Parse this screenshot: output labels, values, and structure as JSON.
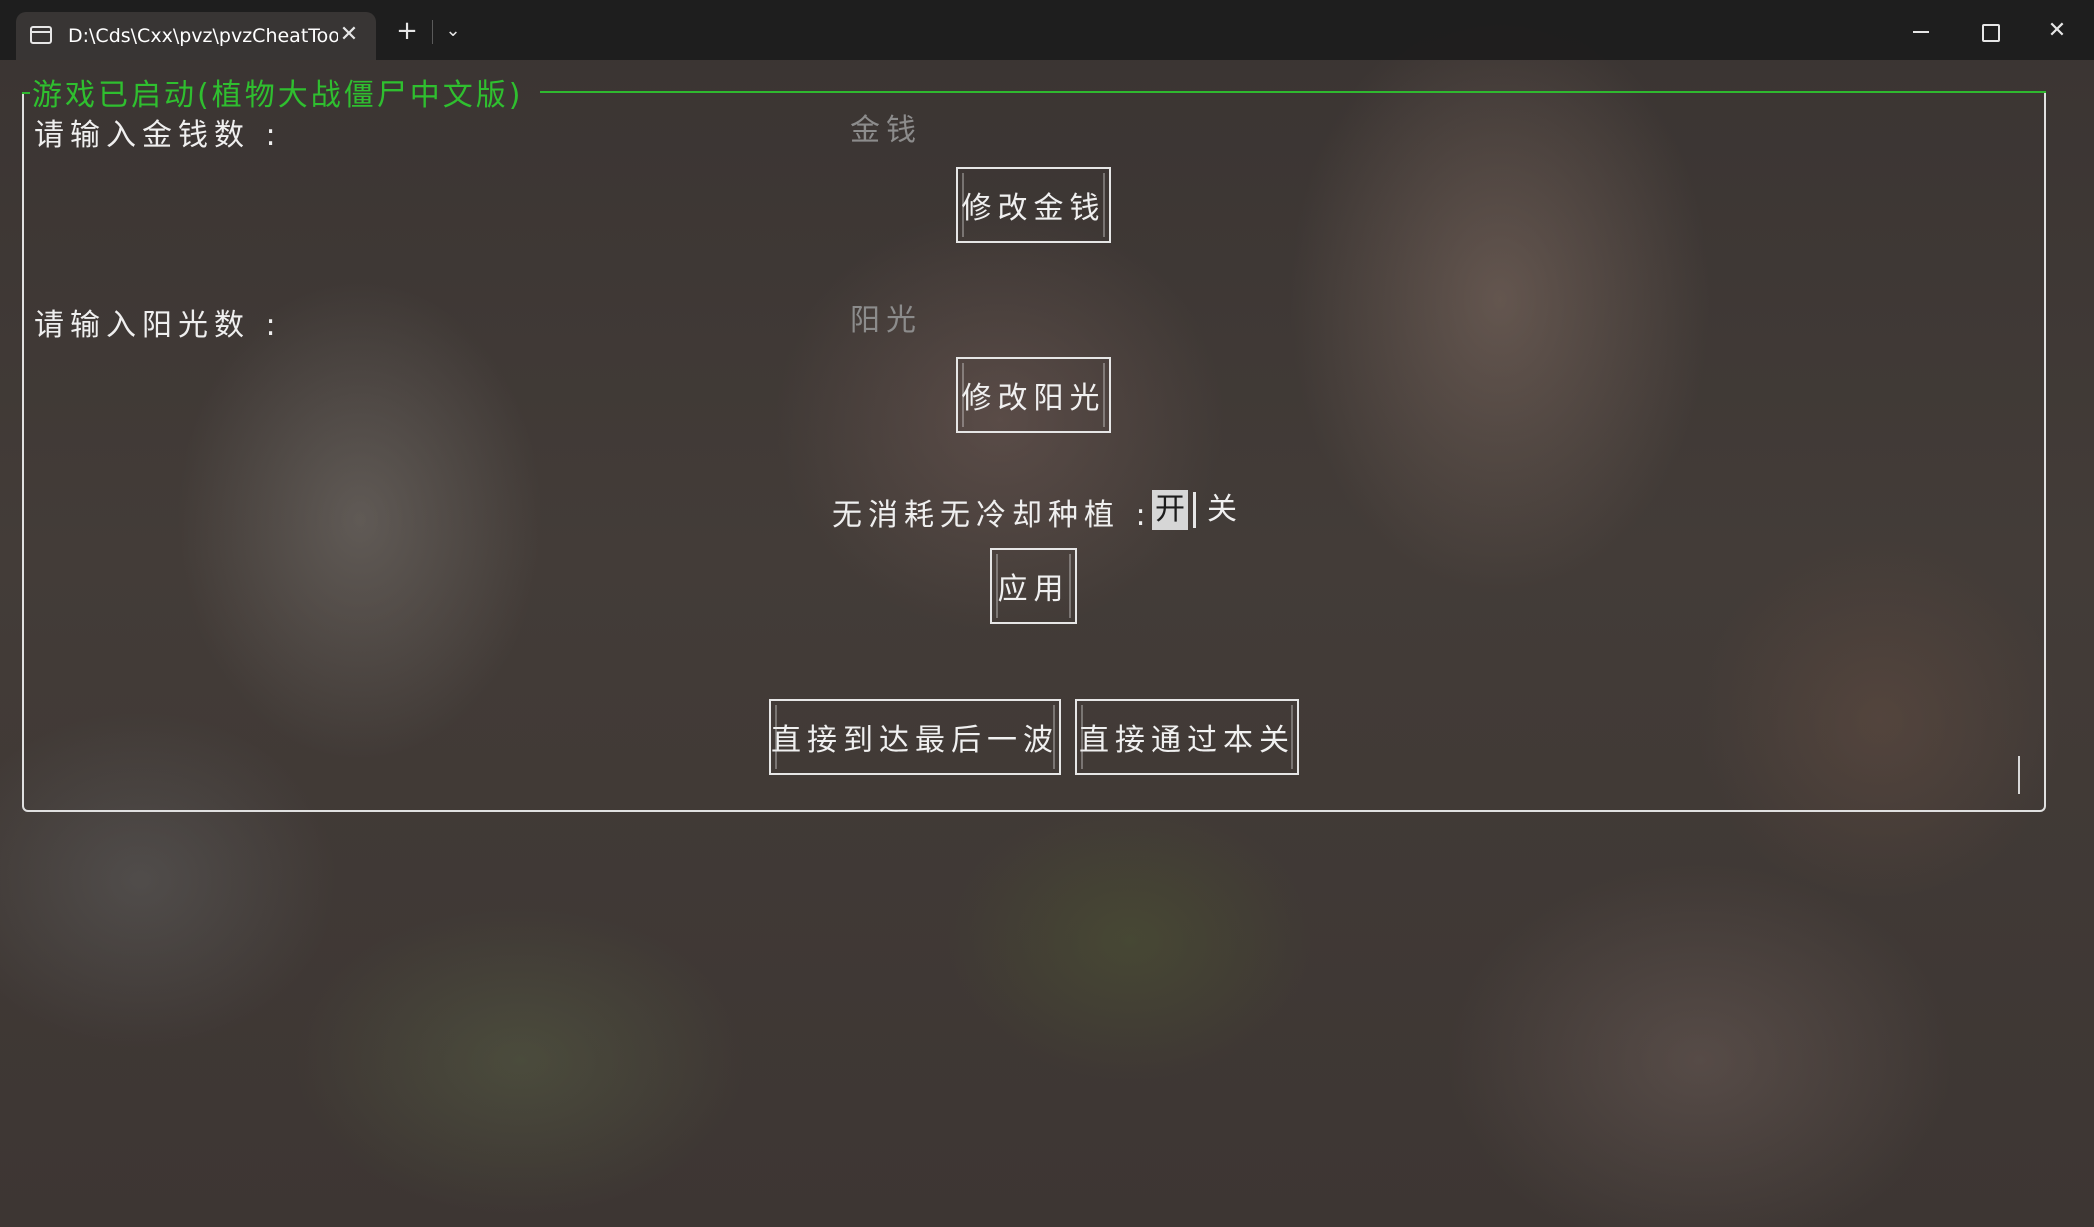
{
  "window": {
    "tab_title": "D:\\Cds\\Cxx\\pvz\\pvzCheatToo",
    "close_tab": "✕",
    "new_tab": "+",
    "tab_menu": "⌄"
  },
  "console": {
    "group_title": "游戏已启动(植物大战僵尸中文版)",
    "money": {
      "label": "请输入金钱数 :",
      "placeholder": "金钱",
      "button": "修改金钱"
    },
    "sun": {
      "label": "请输入阳光数 :",
      "placeholder": "阳光",
      "button": "修改阳光"
    },
    "no_cooldown": {
      "label": "无消耗无冷却种植 :",
      "on": "开",
      "off": "关",
      "selected": "开",
      "apply_button": "应用"
    },
    "skip_to_last_wave_button": "直接到达最后一波",
    "pass_level_button": "直接通过本关"
  }
}
